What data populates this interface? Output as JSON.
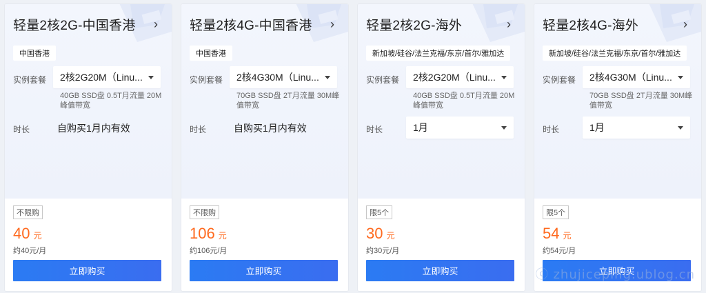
{
  "labels": {
    "plan": "实例套餐",
    "duration": "时长",
    "price_unit": "元",
    "buy": "立即购买"
  },
  "cards": [
    {
      "title": "轻量2核2G-中国香港",
      "region": "中国香港",
      "plan": "2核2G20M（Linu...",
      "desc": "40GB SSD盘 0.5T月流量 20M峰值带宽",
      "duration": "自购买1月内有效",
      "duration_is_select": false,
      "limit": "不限购",
      "price": "40",
      "monthly": "约40元/月"
    },
    {
      "title": "轻量2核4G-中国香港",
      "region": "中国香港",
      "plan": "2核4G30M（Linu...",
      "desc": "70GB SSD盘 2T月流量 30M峰值带宽",
      "duration": "自购买1月内有效",
      "duration_is_select": false,
      "limit": "不限购",
      "price": "106",
      "monthly": "约106元/月"
    },
    {
      "title": "轻量2核2G-海外",
      "region": "新加坡/硅谷/法兰克福/东京/首尔/雅加达",
      "plan": "2核2G20M（Linu...",
      "desc": "40GB SSD盘 0.5T月流量 20M峰值带宽",
      "duration": "1月",
      "duration_is_select": true,
      "limit": "限5个",
      "price": "30",
      "monthly": "约30元/月"
    },
    {
      "title": "轻量2核4G-海外",
      "region": "新加坡/硅谷/法兰克福/东京/首尔/雅加达",
      "plan": "2核4G30M（Linu...",
      "desc": "70GB SSD盘 2T月流量 30M峰值带宽",
      "duration": "1月",
      "duration_is_select": true,
      "limit": "限5个",
      "price": "54",
      "monthly": "约54元/月"
    }
  ],
  "watermark": "ⓒ zhujiceping.ublog.cn",
  "colors": {
    "accent": "#2b7bf3",
    "price": "#ff6a1f"
  }
}
